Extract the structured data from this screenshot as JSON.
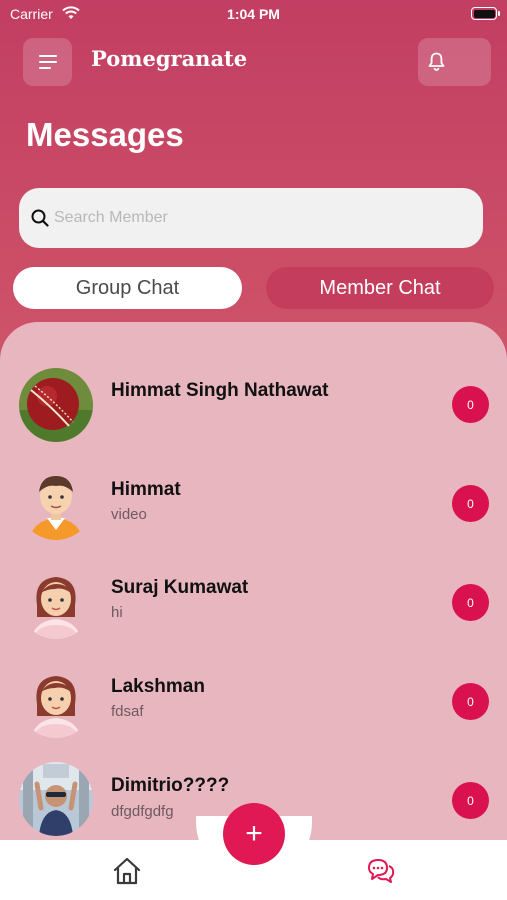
{
  "status_bar": {
    "carrier": "Carrier",
    "time": "1:04 PM"
  },
  "header": {
    "app_title": "Pomegranate",
    "page_title": "Messages"
  },
  "search": {
    "placeholder": "Search Member",
    "value": ""
  },
  "tabs": [
    {
      "label": "Group Chat",
      "selected": true
    },
    {
      "label": "Member Chat",
      "selected": false
    }
  ],
  "chats": [
    {
      "name": "Himmat Singh Nathawat",
      "preview": "",
      "unread": "0",
      "avatar": "cricket-ball-photo"
    },
    {
      "name": "Himmat",
      "preview": "video",
      "unread": "0",
      "avatar": "boy-cartoon"
    },
    {
      "name": "Suraj Kumawat",
      "preview": "hi",
      "unread": "0",
      "avatar": "girl-cartoon"
    },
    {
      "name": "Lakshman",
      "preview": "fdsaf",
      "unread": "0",
      "avatar": "girl-cartoon"
    },
    {
      "name": "Dimitrio????",
      "preview": "dfgdfgdfg",
      "unread": "0",
      "avatar": "person-photo"
    }
  ],
  "bottom_nav": {
    "fab_label": "+"
  },
  "colors": {
    "accent": "#e01853",
    "header_gradient_top": "#c23e62",
    "panel": "#e8b6bf",
    "badge": "#d9124f",
    "chat_nav_active": "#e01853"
  }
}
